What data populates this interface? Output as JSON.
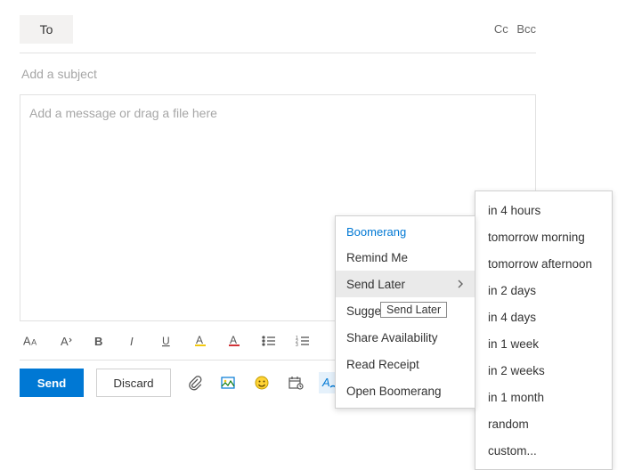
{
  "recipients": {
    "to_label": "To",
    "cc_label": "Cc",
    "bcc_label": "Bcc"
  },
  "subject": {
    "placeholder": "Add a subject",
    "value": ""
  },
  "body": {
    "placeholder": "Add a message or drag a file here",
    "value": ""
  },
  "actions": {
    "send": "Send",
    "discard": "Discard"
  },
  "boomerang": {
    "header": "Boomerang",
    "items": [
      {
        "label": "Remind Me"
      },
      {
        "label": "Send Later",
        "hovered": true,
        "submenu": true,
        "truncated": false
      },
      {
        "label": "Suggest Tim",
        "truncated": true
      },
      {
        "label": "Share Availability"
      },
      {
        "label": "Read Receipt"
      },
      {
        "label": "Open Boomerang"
      }
    ],
    "tooltip": "Send Later"
  },
  "send_later_options": [
    "in 4 hours",
    "tomorrow morning",
    "tomorrow afternoon",
    "in 2 days",
    "in 4 days",
    "in 1 week",
    "in 2 weeks",
    "in 1 month",
    "random",
    "custom..."
  ]
}
